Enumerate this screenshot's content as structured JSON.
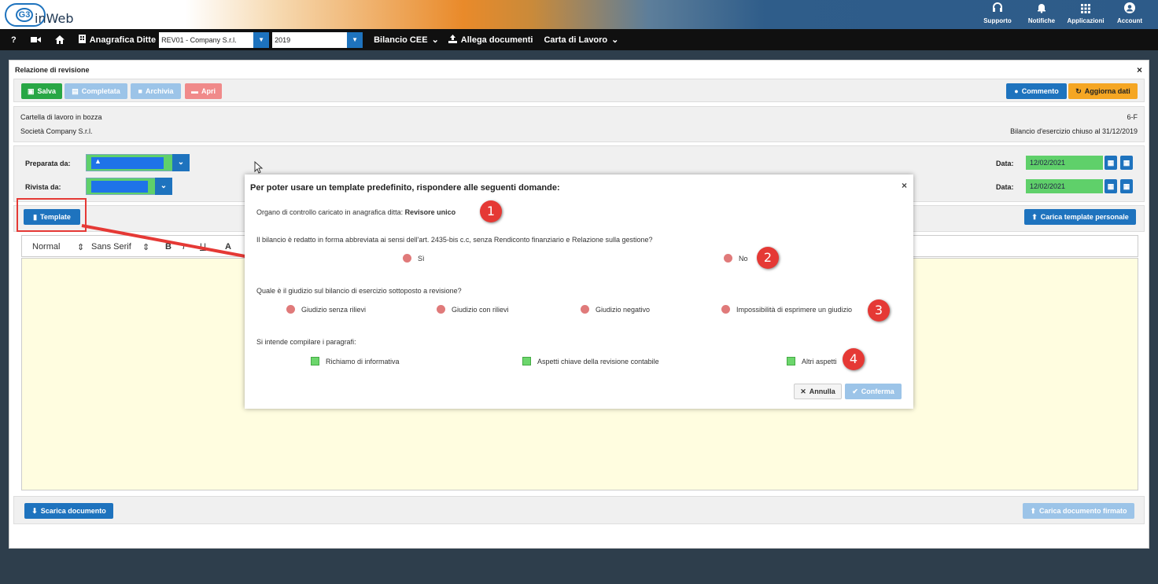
{
  "header": {
    "logo_text": "inWeb",
    "logo_mark": "G3",
    "icons": [
      {
        "name": "headset-icon",
        "label": "Supporto",
        "glyph": "🎧"
      },
      {
        "name": "bell-icon",
        "label": "Notifiche",
        "glyph": "🔔"
      },
      {
        "name": "grid-icon",
        "label": "Applicazioni",
        "glyph": "▦"
      },
      {
        "name": "account-icon",
        "label": "Account",
        "glyph": "●"
      }
    ]
  },
  "nav": {
    "help": "?",
    "anagrafica_label": "Anagrafica Ditte",
    "company_value": "REV01 - Company S.r.l.",
    "year_value": "2019",
    "bilancio_label": "Bilancio CEE",
    "allega_label": "Allega documenti",
    "carta_label": "Carta di Lavoro"
  },
  "panel": {
    "title": "Relazione di revisione",
    "close": "×",
    "toolbar": {
      "salva": "Salva",
      "completata": "Completata",
      "archivia": "Archivia",
      "apri": "Apri",
      "commento": "Commento",
      "aggiorna": "Aggiorna dati"
    },
    "info": {
      "status": "Cartella di lavoro in bozza",
      "company": "Società Company S.r.l.",
      "code": "6-F",
      "bilancio": "Bilancio d'esercizio chiuso al 31/12/2019"
    },
    "form": {
      "preparata_label": "Preparata da:",
      "rivista_label": "Rivista da:",
      "data_label": "Data:",
      "date1": "12/02/2021",
      "date2": "12/02/2021"
    },
    "template_btn": "Template",
    "carica_template": "Carica template personale",
    "editor": {
      "format": "Normal",
      "font": "Sans Serif",
      "bold": "B",
      "italic": "I",
      "underline": "U",
      "color": "A"
    },
    "scarica": "Scarica documento",
    "carica_firmato": "Carica documento firmato"
  },
  "modal": {
    "title": "Per poter usare un template predefinito, rispondere alle seguenti domande:",
    "close": "×",
    "organo_text": "Organo di controllo caricato in anagrafica ditta:",
    "organo_value": "Revisore unico",
    "q1": "Il bilancio è redatto in forma abbreviata ai sensi dell'art. 2435-bis c.c, senza Rendiconto finanziario e Relazione sulla gestione?",
    "q1_opts": [
      "Sì",
      "No"
    ],
    "q2": "Quale è il giudizio sul bilancio di esercizio sottoposto a revisione?",
    "q2_opts": [
      "Giudizio senza rilievi",
      "Giudizio con rilievi",
      "Giudizio negativo",
      "Impossibilità di esprimere un giudizio"
    ],
    "q3": "Si intende compilare i paragrafi:",
    "q3_opts": [
      "Richiamo di informativa",
      "Aspetti chiave della revisione contabile",
      "Altri aspetti"
    ],
    "annulla": "Annulla",
    "conferma": "Conferma",
    "badges": [
      "1",
      "2",
      "3",
      "4"
    ]
  },
  "colors": {
    "green": "#28a745",
    "blue": "#1e73be",
    "orange": "#f5a623",
    "light_blue": "#9cc4e8",
    "pink": "#f08a8a"
  }
}
